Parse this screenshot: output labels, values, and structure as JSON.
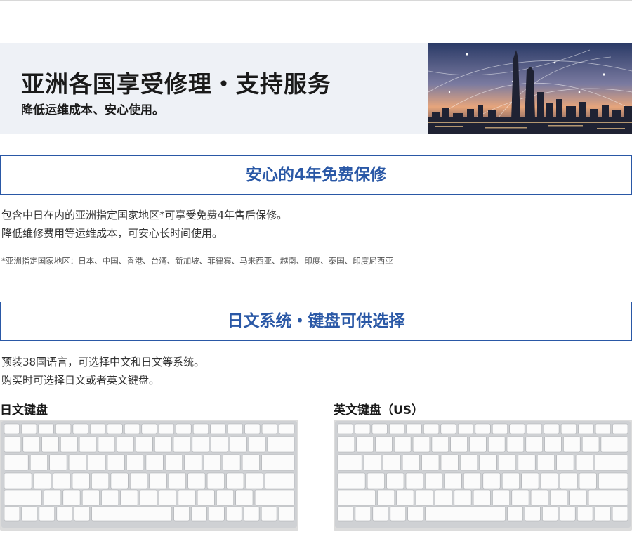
{
  "hero": {
    "title": "亚洲各国享受修理・支持服务",
    "subtitle": "降低运维成本、安心使用。"
  },
  "warranty": {
    "heading": "安心的4年免费保修",
    "lines": [
      "包含中日在内的亚洲指定国家地区*可享受免费4年售后保修。",
      "降低维修费用等运维成本，可安心长时间使用。"
    ],
    "note": "*亚洲指定国家地区：日本、中国、香港、台湾、新加坡、菲律宾、马来西亚、越南、印度、泰国、印度尼西亚"
  },
  "system": {
    "heading": "日文系统・键盘可供选择",
    "lines": [
      "预装38国语言，可选择中文和日文等系统。",
      "购买时可选择日文或者英文键盘。"
    ]
  },
  "keyboards": {
    "jp_label": "日文键盘",
    "us_label": "英文键盘（US）"
  },
  "colors": {
    "accent": "#2a58a6",
    "hero_bg": "#eef1f6"
  }
}
